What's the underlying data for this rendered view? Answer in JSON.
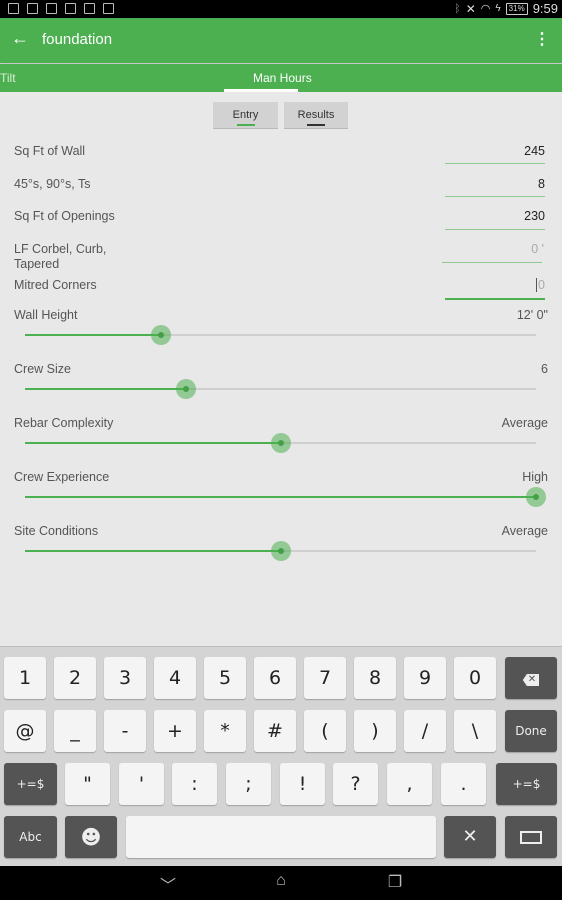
{
  "status_bar": {
    "notification_icons": [
      "gallery-icon",
      "outlook-icon",
      "keyboard-icon",
      "copy-icon",
      "screenshot-icon",
      "play-icon"
    ],
    "system_icons": [
      "bluetooth-icon",
      "nfc-off-icon",
      "wifi-icon",
      "charging-icon"
    ],
    "battery": "31%",
    "time": "9:59"
  },
  "app_bar": {
    "back_icon": "←",
    "title": "foundation",
    "menu_icon": "⋮"
  },
  "tabs": [
    {
      "label": "Tilt",
      "active": false
    },
    {
      "label": "Man Hours",
      "active": true
    }
  ],
  "segments": {
    "entry": {
      "label": "Entry",
      "active": true,
      "underline_color": "#4caf50"
    },
    "results": {
      "label": "Results",
      "active": false,
      "underline_color": "#333333"
    }
  },
  "fields": [
    {
      "label": "Sq Ft of Wall",
      "value": "245"
    },
    {
      "label": "45°s, 90°s, Ts",
      "value": "8"
    },
    {
      "label": "Sq Ft of Openings",
      "value": "230"
    },
    {
      "label": "LF Corbel, Curb, Tapered",
      "value": "",
      "placeholder": "0 '"
    },
    {
      "label": "Mitred Corners",
      "value": "",
      "placeholder": "0",
      "focused": true
    }
  ],
  "sliders": [
    {
      "label": "Wall Height",
      "value_text": "12' 0\"",
      "fraction": 0.266
    },
    {
      "label": "Crew Size",
      "value_text": "6",
      "fraction": 0.315
    },
    {
      "label": "Rebar Complexity",
      "value_text": "Average",
      "fraction": 0.5
    },
    {
      "label": "Crew Experience",
      "value_text": "High",
      "fraction": 1.0
    },
    {
      "label": "Site Conditions",
      "value_text": "Average",
      "fraction": 0.5
    }
  ],
  "keyboard": {
    "row1": [
      "1",
      "2",
      "3",
      "4",
      "5",
      "6",
      "7",
      "8",
      "9",
      "0"
    ],
    "row1_end": "backspace-icon",
    "row2": [
      "@",
      "_",
      "-",
      "+",
      "*",
      "#",
      "(",
      ")",
      "/",
      "\\"
    ],
    "row2_end": "Done",
    "row3_start": "+=$",
    "row3": [
      "\"",
      "'",
      ":",
      ";",
      "!",
      "?",
      ",",
      "."
    ],
    "row3_end": "+=$",
    "row4": {
      "abc": "Abc",
      "emoji": "emoji-icon",
      "space": "",
      "tools": "tools-icon",
      "hide": "keyboard-hide-icon"
    }
  },
  "nav_bar": {
    "back": "back-chevron-icon",
    "home": "home-icon",
    "recents": "recents-icon"
  },
  "colors": {
    "accent": "#4caf50",
    "background": "#e8e8e8"
  }
}
